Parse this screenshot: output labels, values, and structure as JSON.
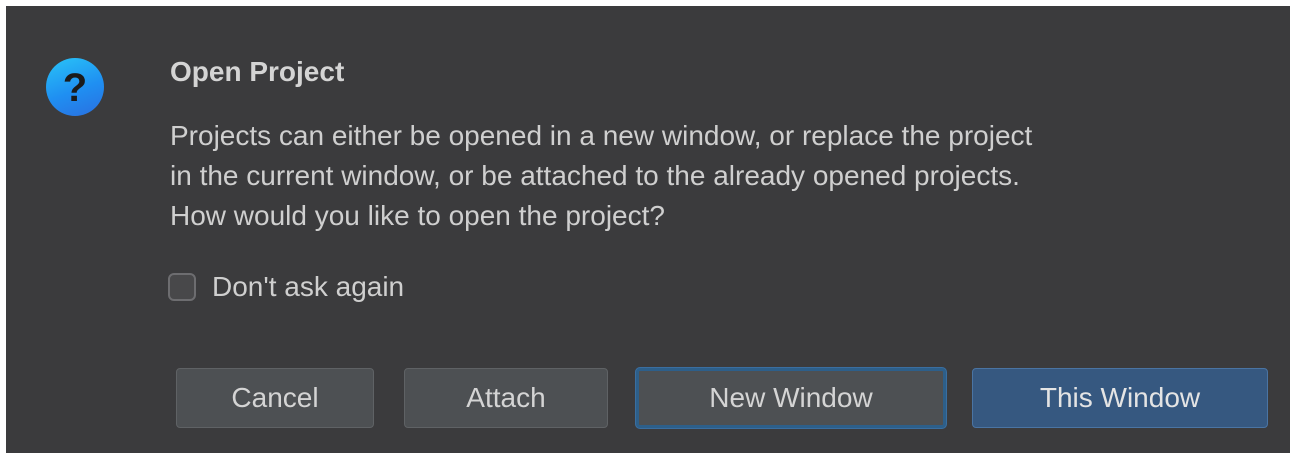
{
  "dialog": {
    "icon": "question-icon",
    "title": "Open Project",
    "message_lines": [
      "Projects can either be opened in a new window, or replace the project",
      "in the current window, or be attached to the already opened projects.",
      "How would you like to open the project?"
    ],
    "checkbox": {
      "label": "Don't ask again",
      "checked": false
    },
    "buttons": {
      "cancel": "Cancel",
      "attach": "Attach",
      "new_window": "New Window",
      "this_window": "This Window"
    }
  },
  "colors": {
    "background": "#3b3b3d",
    "primary_button": "#365880",
    "focus_ring": "#2d5f8a",
    "icon_blue": "#1f8ff2"
  }
}
